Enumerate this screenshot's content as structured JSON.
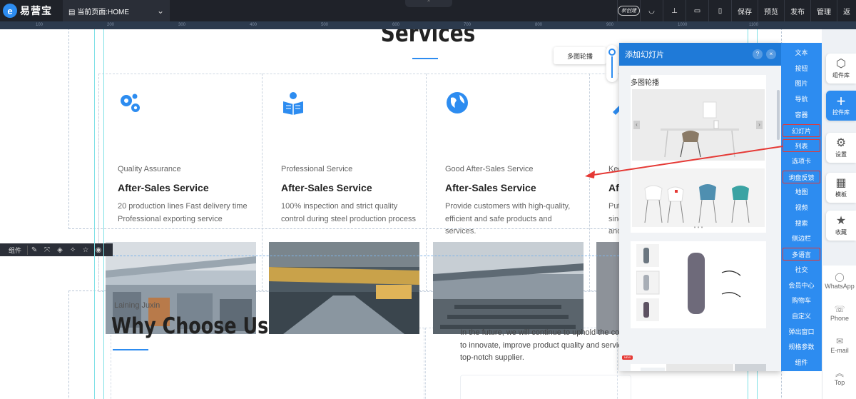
{
  "topbar": {
    "logo_mark": "e",
    "logo_text": "易营宝",
    "page_label": "当前页面:HOME",
    "page_icon": "page-icon",
    "tools": [
      {
        "name": "ai-badge",
        "label": "新创建"
      },
      {
        "name": "eye-icon",
        "label": "◡"
      },
      {
        "name": "align-icon",
        "label": "⊥"
      },
      {
        "name": "desktop-icon",
        "label": "▭"
      },
      {
        "name": "mobile-icon",
        "label": "▯"
      },
      {
        "name": "save-button",
        "label": "保存"
      },
      {
        "name": "preview-button",
        "label": "预览"
      },
      {
        "name": "publish-button",
        "label": "发布"
      },
      {
        "name": "manage-button",
        "label": "管理"
      },
      {
        "name": "exit-button",
        "label": "返"
      }
    ]
  },
  "canvas": {
    "services_title": "Services",
    "cards": [
      {
        "icon": "gears-icon",
        "subtitle": "Quality Assurance",
        "title": "After-Sales Service",
        "desc": "20 production lines Fast delivery time Professional exporting service"
      },
      {
        "icon": "book-reader-icon",
        "subtitle": "Professional Service",
        "title": "After-Sales Service",
        "desc": "100% inspection and strict quality control during steel production process"
      },
      {
        "icon": "globe-icon",
        "subtitle": "Good After-Sales Service",
        "title": "After-Sales Service",
        "desc": "Provide customers with high-quality, efficient and safe products and services."
      },
      {
        "icon": "tools-icon",
        "subtitle": "Kee",
        "title": "Aft",
        "desc": "Put sinc and"
      }
    ],
    "component_toolbar": {
      "label": "组件",
      "icons": [
        "edit-icon",
        "crop-icon",
        "layers-icon",
        "magic-icon",
        "star-icon",
        "eye-icon"
      ]
    },
    "laining": "Laining Juxin",
    "why_title": "Why Choose Us",
    "future_lines": [
      "In the future, we will continue to uphold the co",
      "to innovate, improve product quality and servic",
      "top-notch supplier."
    ]
  },
  "float_tag": "多图轮播",
  "panel": {
    "title": "添加幻灯片",
    "help": "?",
    "close": "×",
    "template_label": "多图轮播",
    "arrow_left": "‹",
    "arrow_right": "›",
    "dots": "• • •",
    "new_badge": "NEW"
  },
  "menu": {
    "items": [
      {
        "label": "文本",
        "highlight": false
      },
      {
        "label": "按钮",
        "highlight": false
      },
      {
        "label": "图片",
        "highlight": false
      },
      {
        "label": "导航",
        "highlight": false
      },
      {
        "label": "容器",
        "highlight": false
      },
      {
        "label": "幻灯片",
        "highlight": true
      },
      {
        "label": "列表",
        "highlight": true
      },
      {
        "label": "选项卡",
        "highlight": false
      },
      {
        "label": "询盘反馈",
        "highlight": true
      },
      {
        "label": "地图",
        "highlight": false
      },
      {
        "label": "视频",
        "highlight": false
      },
      {
        "label": "搜索",
        "highlight": false
      },
      {
        "label": "侧边栏",
        "highlight": false
      },
      {
        "label": "多语言",
        "highlight": true
      },
      {
        "label": "社交",
        "highlight": false
      },
      {
        "label": "会员中心",
        "highlight": false
      },
      {
        "label": "购物车",
        "highlight": false
      },
      {
        "label": "自定义",
        "highlight": false
      },
      {
        "label": "弹出窗口",
        "highlight": false
      },
      {
        "label": "规格参数",
        "highlight": false
      },
      {
        "label": "组件",
        "highlight": false
      }
    ]
  },
  "rail": {
    "buttons": [
      {
        "name": "component-library-button",
        "icon": "cube-icon",
        "glyph": "⬡",
        "label": "组件库",
        "active": false
      },
      {
        "name": "control-library-button",
        "icon": "plus-icon",
        "glyph": "+",
        "label": "控件库",
        "active": true
      },
      {
        "name": "settings-button",
        "icon": "gear-icon",
        "glyph": "⚙",
        "label": "设置",
        "active": false
      },
      {
        "name": "template-button",
        "icon": "grid-icon",
        "glyph": "▦",
        "label": "模板",
        "active": false
      },
      {
        "name": "favorites-button",
        "icon": "star-icon",
        "glyph": "★",
        "label": "收藏",
        "active": false
      }
    ],
    "contacts": [
      {
        "name": "whatsapp",
        "glyph": "◯",
        "label": "WhatsApp"
      },
      {
        "name": "phone",
        "glyph": "☏",
        "label": "Phone"
      },
      {
        "name": "email",
        "glyph": "✉",
        "label": "E-mail"
      },
      {
        "name": "top",
        "glyph": "︽",
        "label": "Top"
      }
    ]
  },
  "colors": {
    "brand_blue": "#2d8cf0",
    "toolbar_dark": "#1f2229",
    "highlight_red": "#e53935"
  },
  "ruler_labels": [
    "100",
    "200",
    "300",
    "400",
    "500",
    "600",
    "700",
    "800",
    "900",
    "1000",
    "1100"
  ]
}
